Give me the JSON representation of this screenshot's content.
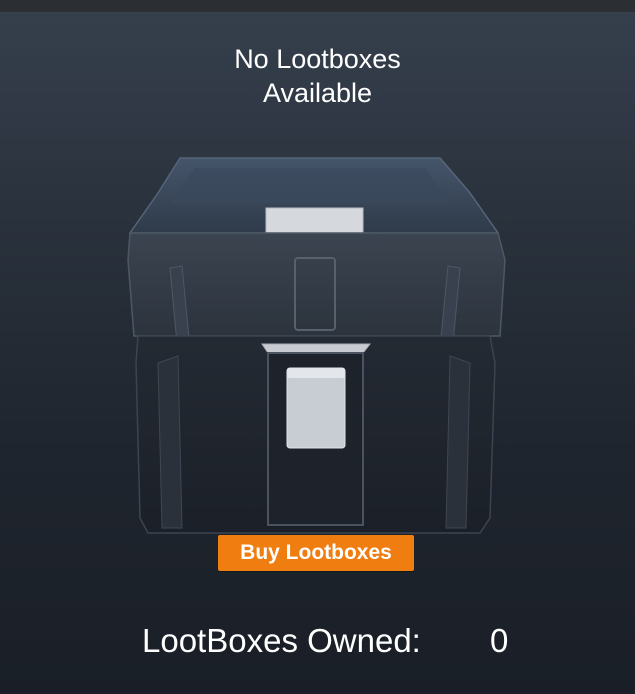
{
  "status_message": "No Lootboxes\nAvailable",
  "buy_button_label": "Buy Lootboxes",
  "owned": {
    "label": "LootBoxes Owned:",
    "count": "0"
  },
  "colors": {
    "accent": "#ef7d10",
    "text": "#ffffff",
    "background": "#1f252e"
  },
  "icons": {
    "chest": "lootbox-chest-icon"
  }
}
